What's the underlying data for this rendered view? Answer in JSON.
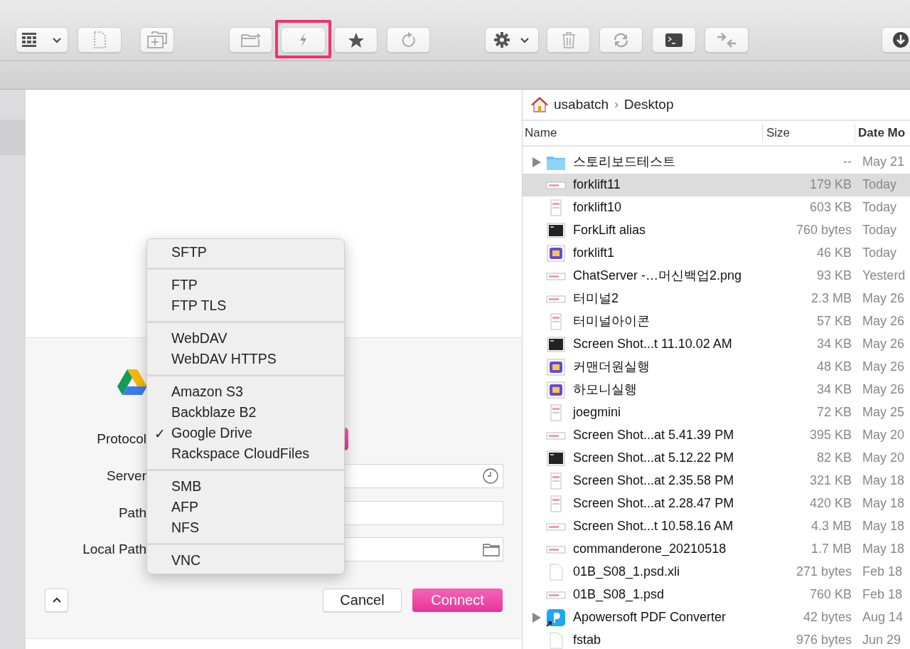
{
  "toolbar": {
    "buttons": [
      {
        "kind": "view-menu",
        "highlighted": false
      },
      {
        "kind": "new-file",
        "highlighted": false
      },
      {
        "kind": "new-tab",
        "highlighted": false
      },
      {
        "kind": "new-folder",
        "highlighted": false
      },
      {
        "kind": "quick-connect",
        "highlighted": true
      },
      {
        "kind": "favorites",
        "highlighted": false
      },
      {
        "kind": "reload",
        "highlighted": false
      },
      {
        "kind": "actions-menu",
        "highlighted": false
      },
      {
        "kind": "trash",
        "highlighted": false
      },
      {
        "kind": "sync",
        "highlighted": false
      },
      {
        "kind": "terminal",
        "highlighted": false
      },
      {
        "kind": "compare",
        "highlighted": false
      },
      {
        "kind": "download",
        "highlighted": false
      }
    ]
  },
  "connect_dialog": {
    "fields": [
      {
        "label": "Protocol",
        "kind": "popup"
      },
      {
        "label": "Server",
        "kind": "history"
      },
      {
        "label": "Path",
        "kind": "text"
      },
      {
        "label": "Local Path",
        "kind": "folder"
      }
    ],
    "cancel": "Cancel",
    "connect": "Connect"
  },
  "protocol_menu": {
    "groups": [
      [
        {
          "label": "SFTP",
          "checked": false
        }
      ],
      [
        {
          "label": "FTP",
          "checked": false
        },
        {
          "label": "FTP TLS",
          "checked": false
        }
      ],
      [
        {
          "label": "WebDAV",
          "checked": false
        },
        {
          "label": "WebDAV HTTPS",
          "checked": false
        }
      ],
      [
        {
          "label": "Amazon S3",
          "checked": false
        },
        {
          "label": "Backblaze B2",
          "checked": false
        },
        {
          "label": "Google Drive",
          "checked": true
        },
        {
          "label": "Rackspace CloudFiles",
          "checked": false
        }
      ],
      [
        {
          "label": "SMB",
          "checked": false
        },
        {
          "label": "AFP",
          "checked": false
        },
        {
          "label": "NFS",
          "checked": false
        }
      ],
      [
        {
          "label": "VNC",
          "checked": false
        }
      ]
    ],
    "check_mark": "✓"
  },
  "file_browser": {
    "breadcrumb": [
      "usabatch",
      "Desktop"
    ],
    "separator": "›",
    "columns": [
      "Name",
      "Size",
      "Date Mo"
    ],
    "rows": [
      {
        "kind": "folder",
        "name": "스토리보드테스트",
        "size": "--",
        "date": "May 21",
        "selected": false,
        "expandable": true
      },
      {
        "kind": "wide",
        "name": "forklift11",
        "size": "179 KB",
        "date": "Today",
        "selected": true,
        "expandable": false
      },
      {
        "kind": "tall",
        "name": "forklift10",
        "size": "603 KB",
        "date": "Today",
        "selected": false,
        "expandable": false
      },
      {
        "kind": "dark",
        "name": "ForkLift alias",
        "size": "760 bytes",
        "date": "Today",
        "selected": false,
        "expandable": false
      },
      {
        "kind": "app",
        "name": "forklift1",
        "size": "46 KB",
        "date": "Today",
        "selected": false,
        "expandable": false
      },
      {
        "kind": "wide",
        "name": "ChatServer -…머신백업2.png",
        "size": "93 KB",
        "date": "Yesterd",
        "selected": false,
        "expandable": false
      },
      {
        "kind": "wide",
        "name": "터미널2",
        "size": "2.3 MB",
        "date": "May 26",
        "selected": false,
        "expandable": false
      },
      {
        "kind": "tall",
        "name": "터미널아이콘",
        "size": "57 KB",
        "date": "May 26",
        "selected": false,
        "expandable": false
      },
      {
        "kind": "dark",
        "name": "Screen Shot...t 11.10.02 AM",
        "size": "34 KB",
        "date": "May 26",
        "selected": false,
        "expandable": false
      },
      {
        "kind": "app",
        "name": "커맨더원실행",
        "size": "48 KB",
        "date": "May 26",
        "selected": false,
        "expandable": false
      },
      {
        "kind": "app",
        "name": "하모니실행",
        "size": "34 KB",
        "date": "May 26",
        "selected": false,
        "expandable": false
      },
      {
        "kind": "tall",
        "name": "joegmini",
        "size": "72 KB",
        "date": "May 25",
        "selected": false,
        "expandable": false
      },
      {
        "kind": "wide",
        "name": "Screen Shot...at 5.41.39 PM",
        "size": "395 KB",
        "date": "May 20",
        "selected": false,
        "expandable": false
      },
      {
        "kind": "dark",
        "name": "Screen Shot...at 5.12.22 PM",
        "size": "82 KB",
        "date": "May 20",
        "selected": false,
        "expandable": false
      },
      {
        "kind": "tall",
        "name": "Screen Shot...at 2.35.58 PM",
        "size": "321 KB",
        "date": "May 18",
        "selected": false,
        "expandable": false
      },
      {
        "kind": "tall",
        "name": "Screen Shot...at 2.28.47 PM",
        "size": "420 KB",
        "date": "May 18",
        "selected": false,
        "expandable": false
      },
      {
        "kind": "wide",
        "name": "Screen Shot...t 10.58.16 AM",
        "size": "4.3 MB",
        "date": "May 18",
        "selected": false,
        "expandable": false
      },
      {
        "kind": "wide",
        "name": "commanderone_20210518",
        "size": "1.7 MB",
        "date": "May 18",
        "selected": false,
        "expandable": false
      },
      {
        "kind": "blank",
        "name": "01B_S08_1.psd.xli",
        "size": "271 bytes",
        "date": "Feb 18",
        "selected": false,
        "expandable": false
      },
      {
        "kind": "wide",
        "name": "01B_S08_1.psd",
        "size": "760 KB",
        "date": "Feb 18",
        "selected": false,
        "expandable": false
      },
      {
        "kind": "alias-app",
        "name": "Apowersoft PDF Converter",
        "size": "42 bytes",
        "date": "Aug 14",
        "selected": false,
        "expandable": true
      },
      {
        "kind": "blank",
        "name": "fstab",
        "size": "976 bytes",
        "date": "Jun 29",
        "selected": false,
        "expandable": false
      }
    ]
  }
}
